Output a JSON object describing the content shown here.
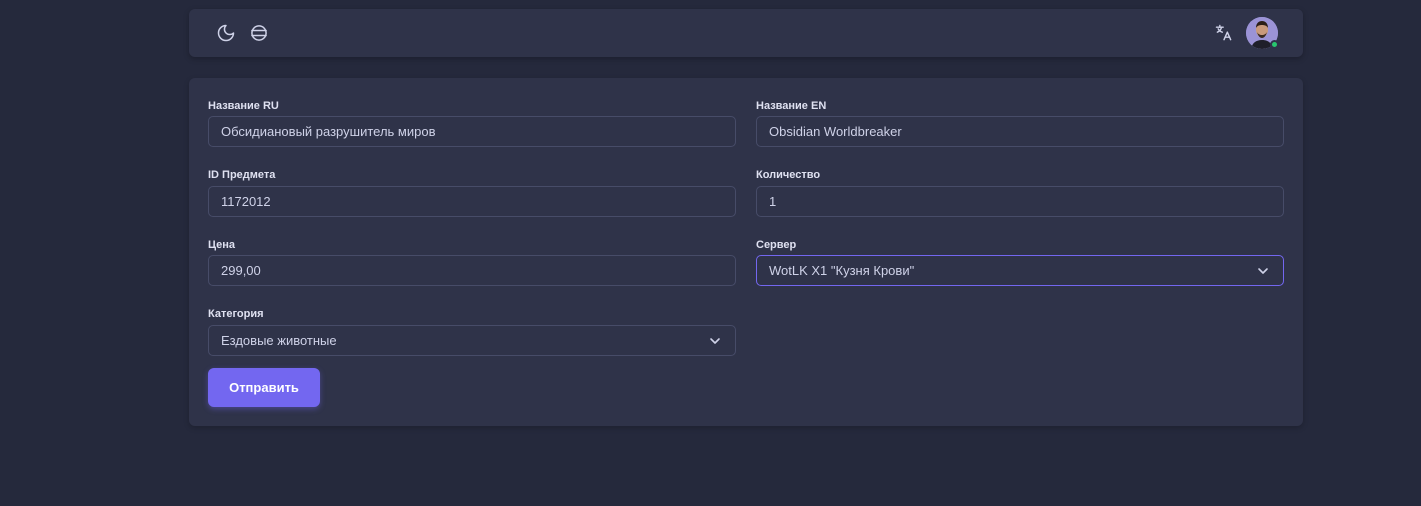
{
  "navbar": {
    "icons": [
      "moon-icon",
      "globe-icon",
      "translate-icon"
    ],
    "avatar_status_color": "#28c76f"
  },
  "form": {
    "name_ru": {
      "label": "Название RU",
      "value": "Обсидиановый разрушитель миров"
    },
    "name_en": {
      "label": "Название EN",
      "value": "Obsidian Worldbreaker"
    },
    "item_id": {
      "label": "ID Предмета",
      "value": "1172012"
    },
    "quantity": {
      "label": "Количество",
      "value": "1"
    },
    "price": {
      "label": "Цена",
      "value": "299,00"
    },
    "server": {
      "label": "Сервер",
      "value": "WotLK X1 \"Кузня Крови\""
    },
    "category": {
      "label": "Категория",
      "value": "Ездовые животные"
    },
    "submit_label": "Отправить"
  },
  "colors": {
    "accent": "#7367f0",
    "background": "#25293c",
    "card": "#2f3349"
  }
}
